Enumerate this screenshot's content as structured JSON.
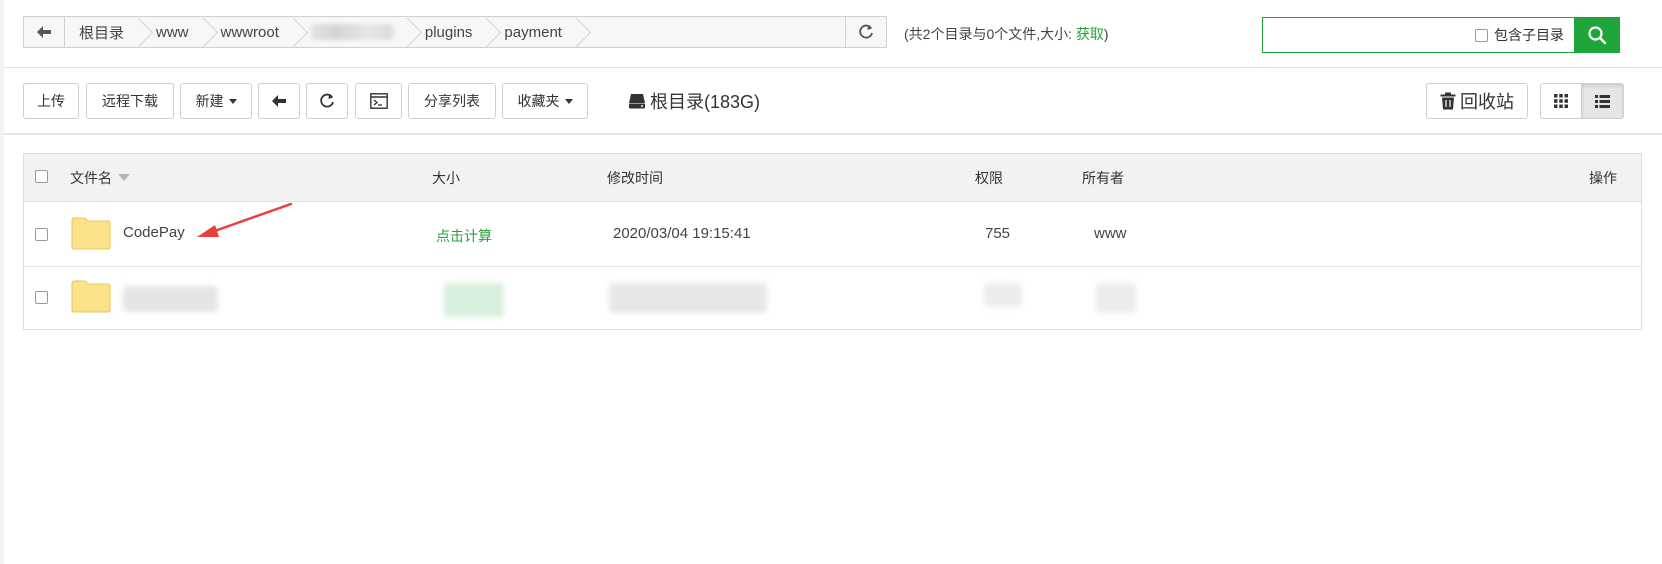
{
  "breadcrumb": {
    "items": [
      "根目录",
      "www",
      "wwwroot",
      "",
      "plugins",
      "payment"
    ]
  },
  "summary": {
    "prefix": "(共2个目录与0个文件,大小: ",
    "link": "获取",
    "suffix": ")"
  },
  "search": {
    "value": "",
    "include_subdir_label": "包含子目录"
  },
  "toolbar": {
    "upload": "上传",
    "remote_download": "远程下载",
    "new": "新建",
    "share_list": "分享列表",
    "favorites": "收藏夹",
    "disk": "根目录(183G)",
    "recycle": "回收站"
  },
  "table": {
    "headers": {
      "name": "文件名",
      "size": "大小",
      "mtime": "修改时间",
      "perm": "权限",
      "owner": "所有者",
      "actions": "操作"
    },
    "rows": [
      {
        "name": "CodePay",
        "size": "点击计算",
        "mtime": "2020/03/04 19:15:41",
        "perm": "755",
        "owner": "www"
      }
    ]
  },
  "colors": {
    "accent": "#20a53a",
    "folder": "#fbe18a",
    "arrow": "#e8413c"
  }
}
